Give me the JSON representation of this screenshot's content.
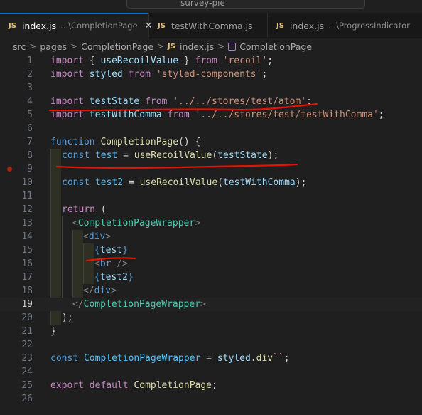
{
  "window": {
    "title": "survey-pie"
  },
  "tabs": [
    {
      "label": "index.js",
      "description": "...\\CompletionPage",
      "active": true,
      "close_glyph": "✕"
    },
    {
      "label": "testWithComma.js",
      "description": "",
      "active": false
    },
    {
      "label": "index.js",
      "description": "...\\ProgressIndicator",
      "active": false
    }
  ],
  "breadcrumb": [
    "src",
    "pages",
    "CompletionPage",
    "index.js",
    "CompletionPage"
  ],
  "file_badge": "JS",
  "editor": {
    "current_line": 19,
    "breakpoint_line": 9,
    "line_numbers": [
      "1",
      "2",
      "3",
      "4",
      "5",
      "6",
      "7",
      "8",
      "9",
      "10",
      "11",
      "12",
      "13",
      "14",
      "15",
      "16",
      "17",
      "18",
      "19",
      "20",
      "21",
      "22",
      "23",
      "24",
      "25",
      "26"
    ],
    "code": {
      "l1": {
        "k": "import",
        "p1": "{ ",
        "f": "useRecoilValue",
        "p2": " } ",
        "k2": "from",
        "s": "'recoil'",
        "e": ";"
      },
      "l2": {
        "k": "import",
        "v": "styled",
        "k2": "from",
        "s": "'styled-components'",
        "e": ";"
      },
      "l4": {
        "k": "import",
        "v": "testState",
        "k2": "from",
        "s": "'../../stores/test/atom'",
        "e": ";"
      },
      "l5": {
        "k": "import",
        "v": "testWithComma",
        "k2": "from",
        "s": "'../../stores/test/testWithComma'",
        "e": ";"
      },
      "l7": {
        "k": "function",
        "f": "CompletionPage",
        "p": "() {"
      },
      "l8": {
        "k": "const",
        "c": "test",
        "op": " = ",
        "f": "useRecoilValue",
        "p1": "(",
        "v": "testState",
        "p2": ");"
      },
      "l10": {
        "k": "const",
        "c": "test2",
        "op": " = ",
        "f": "useRecoilValue",
        "p1": "(",
        "v": "testWithComma",
        "p2": ");"
      },
      "l12": {
        "k": "return",
        "p": " ("
      },
      "l13": {
        "lt": "<",
        "t": "CompletionPageWrapper",
        "gt": ">"
      },
      "l14": {
        "lt": "<",
        "t": "div",
        "gt": ">"
      },
      "l15": {
        "o": "{",
        "v": "test",
        "c": "}"
      },
      "l16": {
        "lt": "<",
        "t": "br",
        "gt": " />"
      },
      "l17": {
        "o": "{",
        "v": "test2",
        "c": "}"
      },
      "l18": {
        "lt": "</",
        "t": "div",
        "gt": ">"
      },
      "l19": {
        "lt": "</",
        "t": "CompletionPageWrapper",
        "gt": ">"
      },
      "l20": {
        "p": ");"
      },
      "l21": {
        "p": "}"
      },
      "l23": {
        "k": "const",
        "t": "CompletionPageWrapper",
        "op": " = ",
        "v": "styled",
        "d": ".",
        "f": "div",
        "s": "``",
        "e": ";"
      },
      "l25": {
        "k": "export",
        "k2": "default",
        "f": "CompletionPage",
        "e": ";"
      }
    }
  },
  "colors": {
    "keyword": "#569cd6",
    "string": "#ce9178",
    "function": "#dcdcaa",
    "variable": "#9cdcfe",
    "constant": "#4fc1ff",
    "type": "#4ec9b0",
    "annotation": "#e51400",
    "breakpoint": "#a1260d",
    "tab_accent": "#0078d4"
  }
}
